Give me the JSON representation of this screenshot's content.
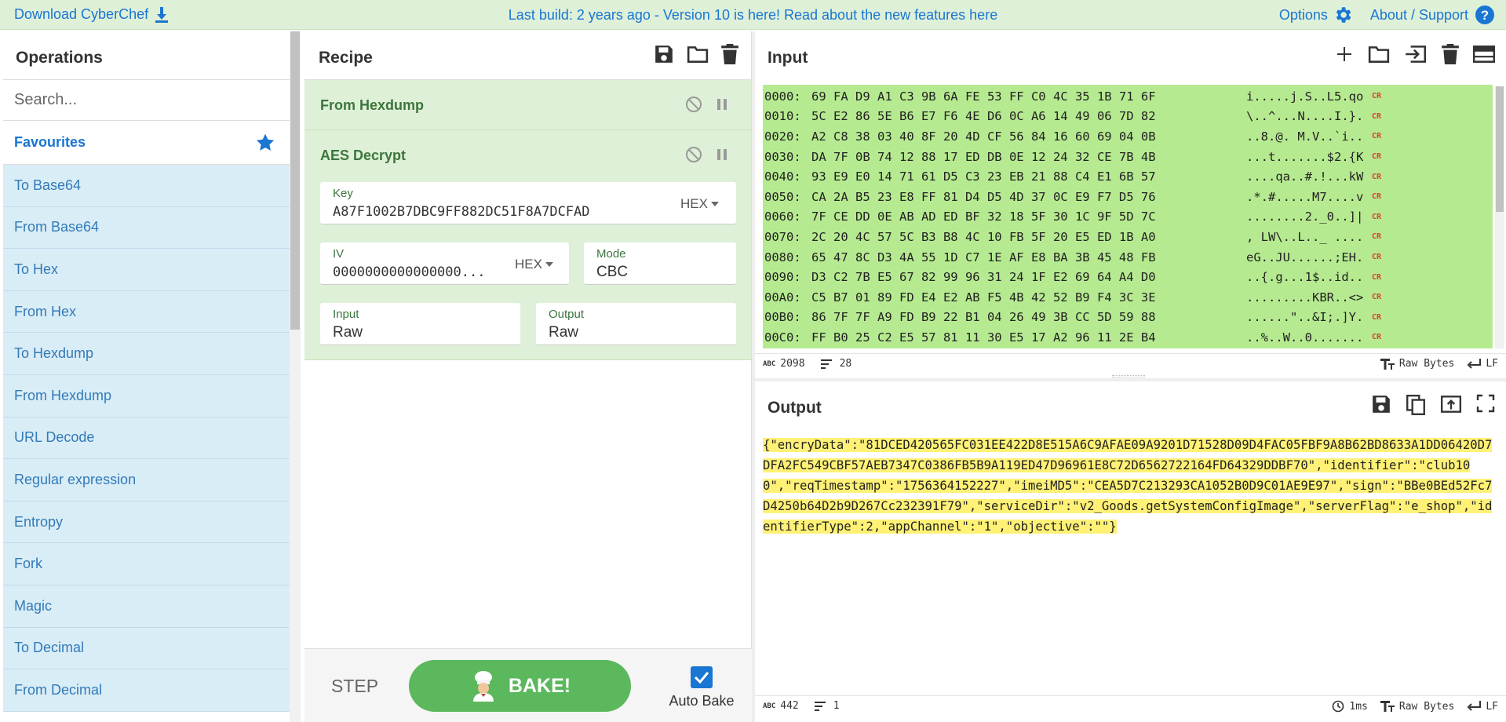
{
  "banner": {
    "download_label": "Download CyberChef",
    "build_text": "Last build: 2 years ago - Version 10 is here! Read about the new features ",
    "here_link": "here",
    "options_label": "Options",
    "about_label": "About / Support"
  },
  "operations": {
    "title": "Operations",
    "search_placeholder": "Search...",
    "favourites_label": "Favourites",
    "items": [
      "To Base64",
      "From Base64",
      "To Hex",
      "From Hex",
      "To Hexdump",
      "From Hexdump",
      "URL Decode",
      "Regular expression",
      "Entropy",
      "Fork",
      "Magic",
      "To Decimal",
      "From Decimal"
    ]
  },
  "recipe": {
    "title": "Recipe",
    "ops": [
      {
        "name": "From Hexdump"
      },
      {
        "name": "AES Decrypt",
        "key_label": "Key",
        "key_value": "A87F1002B7DBC9FF882DC51F8A7DCFAD",
        "key_encoding": "HEX",
        "iv_label": "IV",
        "iv_value": "0000000000000000...",
        "iv_encoding": "HEX",
        "mode_label": "Mode",
        "mode_value": "CBC",
        "input_label": "Input",
        "input_value": "Raw",
        "output_label": "Output",
        "output_value": "Raw"
      }
    ],
    "step_label": "STEP",
    "bake_label": "BAKE!",
    "autobake_label": "Auto Bake"
  },
  "input": {
    "title": "Input",
    "lines": [
      {
        "addr": "0000:",
        "bytes": "69 FA D9 A1 C3 9B 6A FE 53 FF C0 4C 35 1B 71 6F",
        "ascii": "i.....j.S..L5.qo"
      },
      {
        "addr": "0010:",
        "bytes": "5C E2 86 5E B6 E7 F6 4E D6 0C A6 14 49 06 7D 82",
        "ascii": "\\..^...N....I.}."
      },
      {
        "addr": "0020:",
        "bytes": "A2 C8 38 03 40 8F 20 4D CF 56 84 16 60 69 04 0B",
        "ascii": "..8.@. M.V..`i.."
      },
      {
        "addr": "0030:",
        "bytes": "DA 7F 0B 74 12 88 17 ED DB 0E 12 24 32 CE 7B 4B",
        "ascii": "...t.......$2.{K"
      },
      {
        "addr": "0040:",
        "bytes": "93 E9 E0 14 71 61 D5 C3 23 EB 21 88 C4 E1 6B 57",
        "ascii": "....qa..#.!...kW"
      },
      {
        "addr": "0050:",
        "bytes": "CA 2A B5 23 E8 FF 81 D4 D5 4D 37 0C E9 F7 D5 76",
        "ascii": ".*.#.....M7....v"
      },
      {
        "addr": "0060:",
        "bytes": "7F CE DD 0E AB AD ED BF 32 18 5F 30 1C 9F 5D 7C",
        "ascii": "........2._0..]|"
      },
      {
        "addr": "0070:",
        "bytes": "2C 20 4C 57 5C B3 B8 4C 10 FB 5F 20 E5 ED 1B A0",
        "ascii": ", LW\\..L.._ ...."
      },
      {
        "addr": "0080:",
        "bytes": "65 47 8C D3 4A 55 1D C7 1E AF E8 BA 3B 45 48 FB",
        "ascii": "eG..JU......;EH."
      },
      {
        "addr": "0090:",
        "bytes": "D3 C2 7B E5 67 82 99 96 31 24 1F E2 69 64 A4 D0",
        "ascii": "..{.g...1$..id.."
      },
      {
        "addr": "00A0:",
        "bytes": "C5 B7 01 89 FD E4 E2 AB F5 4B 42 52 B9 F4 3C 3E",
        "ascii": ".........KBR..<>"
      },
      {
        "addr": "00B0:",
        "bytes": "86 7F 7F A9 FD B9 22 B1 04 26 49 3B CC 5D 59 88",
        "ascii": "......\"..&I;.]Y."
      },
      {
        "addr": "00C0:",
        "bytes": "FF B0 25 C2 E5 57 81 11 30 E5 17 A2 96 11 2E B4",
        "ascii": "..%..W..0......."
      }
    ],
    "cr_marker": "CR",
    "char_count": "2098",
    "line_count": "28",
    "encoding": "Raw Bytes",
    "eol": "LF"
  },
  "output": {
    "title": "Output",
    "text": "{\"encryData\":\"81DCED420565FC031EE422D8E515A6C9AFAE09A9201D71528D09D4FAC05FBF9A8B62BD8633A1DD06420D7DFA2FC549CBF57AEB7347C0386FB5B9A119ED47D96961E8C72D6562722164FD64329DDBF70\",\"identifier\":\"club100\",\"reqTimestamp\":\"1756364152227\",\"imeiMD5\":\"CEA5D7C213293CA1052B0D9C01AE9E97\",\"sign\":\"BBe0BEd52Fc7D4250b64D2b9D267Cc232391F79\",\"serviceDir\":\"v2_Goods.getSystemConfigImage\",\"serverFlag\":\"e_shop\",\"identifierType\":2,\"appChannel\":\"1\",\"objective\":\"\"}",
    "char_count": "442",
    "line_count": "1",
    "time": "1ms",
    "encoding": "Raw Bytes",
    "eol": "LF"
  },
  "colors": {
    "accent": "#1976d2",
    "recipe_green": "#dff0d8",
    "op_blue": "#d9edf7",
    "bake_green": "#5cb85c",
    "input_highlight": "#b6ea90",
    "output_highlight": "#fff176"
  }
}
